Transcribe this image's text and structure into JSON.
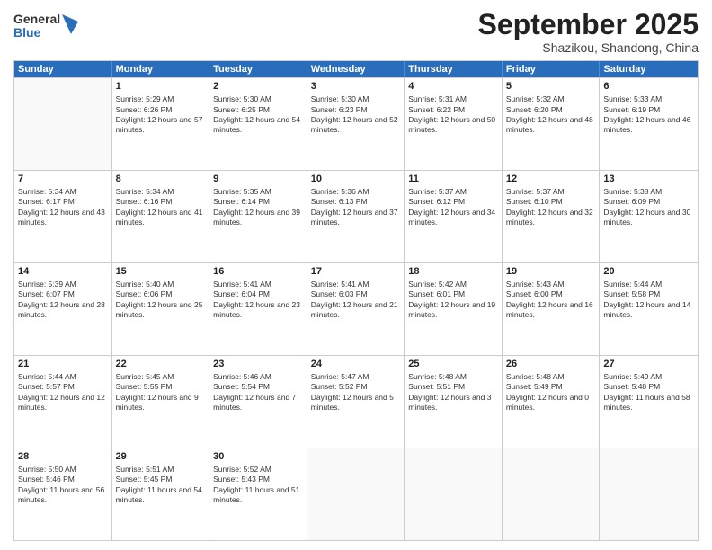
{
  "header": {
    "logo": {
      "general": "General",
      "blue": "Blue"
    },
    "title": "September 2025",
    "location": "Shazikou, Shandong, China"
  },
  "days_header": [
    "Sunday",
    "Monday",
    "Tuesday",
    "Wednesday",
    "Thursday",
    "Friday",
    "Saturday"
  ],
  "weeks": [
    [
      {
        "day": "",
        "empty": true
      },
      {
        "day": "1",
        "sunrise": "Sunrise: 5:29 AM",
        "sunset": "Sunset: 6:26 PM",
        "daylight": "Daylight: 12 hours and 57 minutes."
      },
      {
        "day": "2",
        "sunrise": "Sunrise: 5:30 AM",
        "sunset": "Sunset: 6:25 PM",
        "daylight": "Daylight: 12 hours and 54 minutes."
      },
      {
        "day": "3",
        "sunrise": "Sunrise: 5:30 AM",
        "sunset": "Sunset: 6:23 PM",
        "daylight": "Daylight: 12 hours and 52 minutes."
      },
      {
        "day": "4",
        "sunrise": "Sunrise: 5:31 AM",
        "sunset": "Sunset: 6:22 PM",
        "daylight": "Daylight: 12 hours and 50 minutes."
      },
      {
        "day": "5",
        "sunrise": "Sunrise: 5:32 AM",
        "sunset": "Sunset: 6:20 PM",
        "daylight": "Daylight: 12 hours and 48 minutes."
      },
      {
        "day": "6",
        "sunrise": "Sunrise: 5:33 AM",
        "sunset": "Sunset: 6:19 PM",
        "daylight": "Daylight: 12 hours and 46 minutes."
      }
    ],
    [
      {
        "day": "7",
        "sunrise": "Sunrise: 5:34 AM",
        "sunset": "Sunset: 6:17 PM",
        "daylight": "Daylight: 12 hours and 43 minutes."
      },
      {
        "day": "8",
        "sunrise": "Sunrise: 5:34 AM",
        "sunset": "Sunset: 6:16 PM",
        "daylight": "Daylight: 12 hours and 41 minutes."
      },
      {
        "day": "9",
        "sunrise": "Sunrise: 5:35 AM",
        "sunset": "Sunset: 6:14 PM",
        "daylight": "Daylight: 12 hours and 39 minutes."
      },
      {
        "day": "10",
        "sunrise": "Sunrise: 5:36 AM",
        "sunset": "Sunset: 6:13 PM",
        "daylight": "Daylight: 12 hours and 37 minutes."
      },
      {
        "day": "11",
        "sunrise": "Sunrise: 5:37 AM",
        "sunset": "Sunset: 6:12 PM",
        "daylight": "Daylight: 12 hours and 34 minutes."
      },
      {
        "day": "12",
        "sunrise": "Sunrise: 5:37 AM",
        "sunset": "Sunset: 6:10 PM",
        "daylight": "Daylight: 12 hours and 32 minutes."
      },
      {
        "day": "13",
        "sunrise": "Sunrise: 5:38 AM",
        "sunset": "Sunset: 6:09 PM",
        "daylight": "Daylight: 12 hours and 30 minutes."
      }
    ],
    [
      {
        "day": "14",
        "sunrise": "Sunrise: 5:39 AM",
        "sunset": "Sunset: 6:07 PM",
        "daylight": "Daylight: 12 hours and 28 minutes."
      },
      {
        "day": "15",
        "sunrise": "Sunrise: 5:40 AM",
        "sunset": "Sunset: 6:06 PM",
        "daylight": "Daylight: 12 hours and 25 minutes."
      },
      {
        "day": "16",
        "sunrise": "Sunrise: 5:41 AM",
        "sunset": "Sunset: 6:04 PM",
        "daylight": "Daylight: 12 hours and 23 minutes."
      },
      {
        "day": "17",
        "sunrise": "Sunrise: 5:41 AM",
        "sunset": "Sunset: 6:03 PM",
        "daylight": "Daylight: 12 hours and 21 minutes."
      },
      {
        "day": "18",
        "sunrise": "Sunrise: 5:42 AM",
        "sunset": "Sunset: 6:01 PM",
        "daylight": "Daylight: 12 hours and 19 minutes."
      },
      {
        "day": "19",
        "sunrise": "Sunrise: 5:43 AM",
        "sunset": "Sunset: 6:00 PM",
        "daylight": "Daylight: 12 hours and 16 minutes."
      },
      {
        "day": "20",
        "sunrise": "Sunrise: 5:44 AM",
        "sunset": "Sunset: 5:58 PM",
        "daylight": "Daylight: 12 hours and 14 minutes."
      }
    ],
    [
      {
        "day": "21",
        "sunrise": "Sunrise: 5:44 AM",
        "sunset": "Sunset: 5:57 PM",
        "daylight": "Daylight: 12 hours and 12 minutes."
      },
      {
        "day": "22",
        "sunrise": "Sunrise: 5:45 AM",
        "sunset": "Sunset: 5:55 PM",
        "daylight": "Daylight: 12 hours and 9 minutes."
      },
      {
        "day": "23",
        "sunrise": "Sunrise: 5:46 AM",
        "sunset": "Sunset: 5:54 PM",
        "daylight": "Daylight: 12 hours and 7 minutes."
      },
      {
        "day": "24",
        "sunrise": "Sunrise: 5:47 AM",
        "sunset": "Sunset: 5:52 PM",
        "daylight": "Daylight: 12 hours and 5 minutes."
      },
      {
        "day": "25",
        "sunrise": "Sunrise: 5:48 AM",
        "sunset": "Sunset: 5:51 PM",
        "daylight": "Daylight: 12 hours and 3 minutes."
      },
      {
        "day": "26",
        "sunrise": "Sunrise: 5:48 AM",
        "sunset": "Sunset: 5:49 PM",
        "daylight": "Daylight: 12 hours and 0 minutes."
      },
      {
        "day": "27",
        "sunrise": "Sunrise: 5:49 AM",
        "sunset": "Sunset: 5:48 PM",
        "daylight": "Daylight: 11 hours and 58 minutes."
      }
    ],
    [
      {
        "day": "28",
        "sunrise": "Sunrise: 5:50 AM",
        "sunset": "Sunset: 5:46 PM",
        "daylight": "Daylight: 11 hours and 56 minutes."
      },
      {
        "day": "29",
        "sunrise": "Sunrise: 5:51 AM",
        "sunset": "Sunset: 5:45 PM",
        "daylight": "Daylight: 11 hours and 54 minutes."
      },
      {
        "day": "30",
        "sunrise": "Sunrise: 5:52 AM",
        "sunset": "Sunset: 5:43 PM",
        "daylight": "Daylight: 11 hours and 51 minutes."
      },
      {
        "day": "",
        "empty": true
      },
      {
        "day": "",
        "empty": true
      },
      {
        "day": "",
        "empty": true
      },
      {
        "day": "",
        "empty": true
      }
    ]
  ]
}
